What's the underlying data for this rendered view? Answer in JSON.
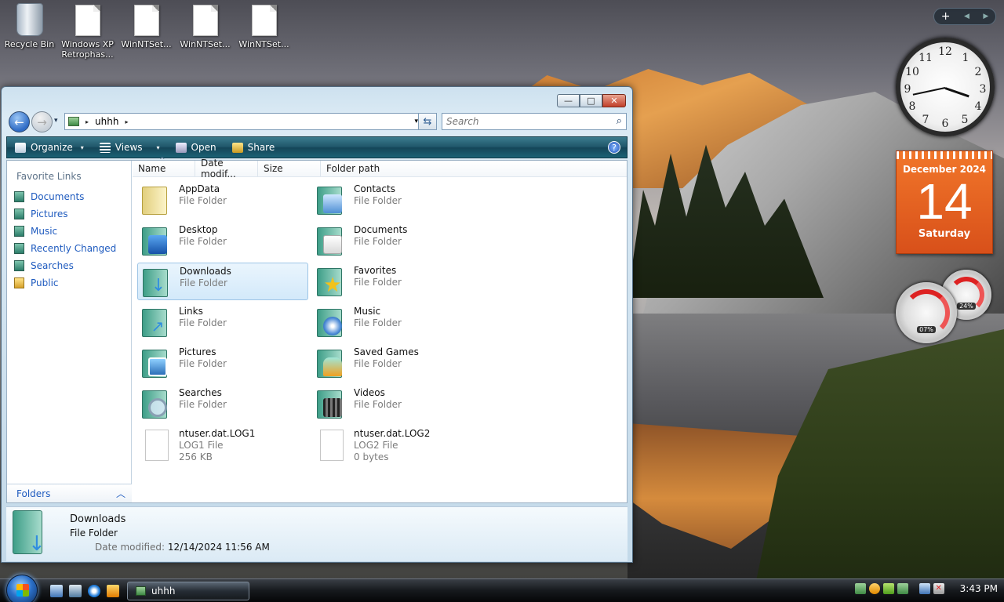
{
  "desktop": {
    "icons": [
      {
        "label": "Recycle Bin"
      },
      {
        "label": "Windows XP Retrophas..."
      },
      {
        "label": "WinNTSet..."
      },
      {
        "label": "WinNTSet..."
      },
      {
        "label": "WinNTSet..."
      }
    ]
  },
  "gadgets": {
    "bar": {
      "add": "+",
      "prev": "◀",
      "next": "▶"
    },
    "clock": {
      "numbers": [
        "12",
        "1",
        "2",
        "3",
        "4",
        "5",
        "6",
        "7",
        "8",
        "9",
        "10",
        "11"
      ]
    },
    "calendar": {
      "month": "December 2024",
      "day": "14",
      "weekday": "Saturday"
    },
    "cpu": {
      "label": "07%",
      "value": 0.07
    },
    "memory": {
      "label": "24%",
      "value": 0.24
    }
  },
  "window": {
    "controls": {
      "minimize": "—",
      "maximize": "□",
      "close": "✕"
    },
    "address": {
      "crumb": "uhhh",
      "arrow": "▸",
      "dropdown": "▾"
    },
    "refresh": "⇆",
    "search": {
      "placeholder": "Search",
      "icon": "⌕"
    },
    "toolbar": {
      "organize": "Organize",
      "views": "Views",
      "open": "Open",
      "share": "Share",
      "caret": "▾",
      "help": "?"
    },
    "nav": {
      "header": "Favorite Links",
      "links": [
        "Documents",
        "Pictures",
        "Music",
        "Recently Changed",
        "Searches",
        "Public"
      ],
      "folders": "Folders",
      "folders_chevron": "︿"
    },
    "columns": [
      "Name",
      "Date modif...",
      "Size",
      "Folder path"
    ],
    "items": [
      {
        "name": "AppData",
        "type": "File Folder",
        "icon": "plain-folder-icon"
      },
      {
        "name": "Contacts",
        "type": "File Folder",
        "icon": "contacts-folder-icon"
      },
      {
        "name": "Desktop",
        "type": "File Folder",
        "icon": "desktop-folder-icon"
      },
      {
        "name": "Documents",
        "type": "File Folder",
        "icon": "documents-folder-icon"
      },
      {
        "name": "Downloads",
        "type": "File Folder",
        "icon": "downloads-folder-icon"
      },
      {
        "name": "Favorites",
        "type": "File Folder",
        "icon": "favorites-folder-icon"
      },
      {
        "name": "Links",
        "type": "File Folder",
        "icon": "links-folder-icon"
      },
      {
        "name": "Music",
        "type": "File Folder",
        "icon": "music-folder-icon"
      },
      {
        "name": "Pictures",
        "type": "File Folder",
        "icon": "pictures-folder-icon"
      },
      {
        "name": "Saved Games",
        "type": "File Folder",
        "icon": "saved-games-folder-icon"
      },
      {
        "name": "Searches",
        "type": "File Folder",
        "icon": "searches-folder-icon"
      },
      {
        "name": "Videos",
        "type": "File Folder",
        "icon": "videos-folder-icon"
      },
      {
        "name": "ntuser.dat.LOG1",
        "type": "LOG1 File",
        "size": "256 KB",
        "icon": "file-icon"
      },
      {
        "name": "ntuser.dat.LOG2",
        "type": "LOG2 File",
        "size": "0 bytes",
        "icon": "file-icon"
      }
    ],
    "selected": "Downloads",
    "details": {
      "name": "Downloads",
      "type": "File Folder",
      "date_label": "Date modified:",
      "date_value": "12/14/2024 11:56 AM"
    }
  },
  "taskbar": {
    "task": "uhhh",
    "time": "3:43 PM"
  }
}
